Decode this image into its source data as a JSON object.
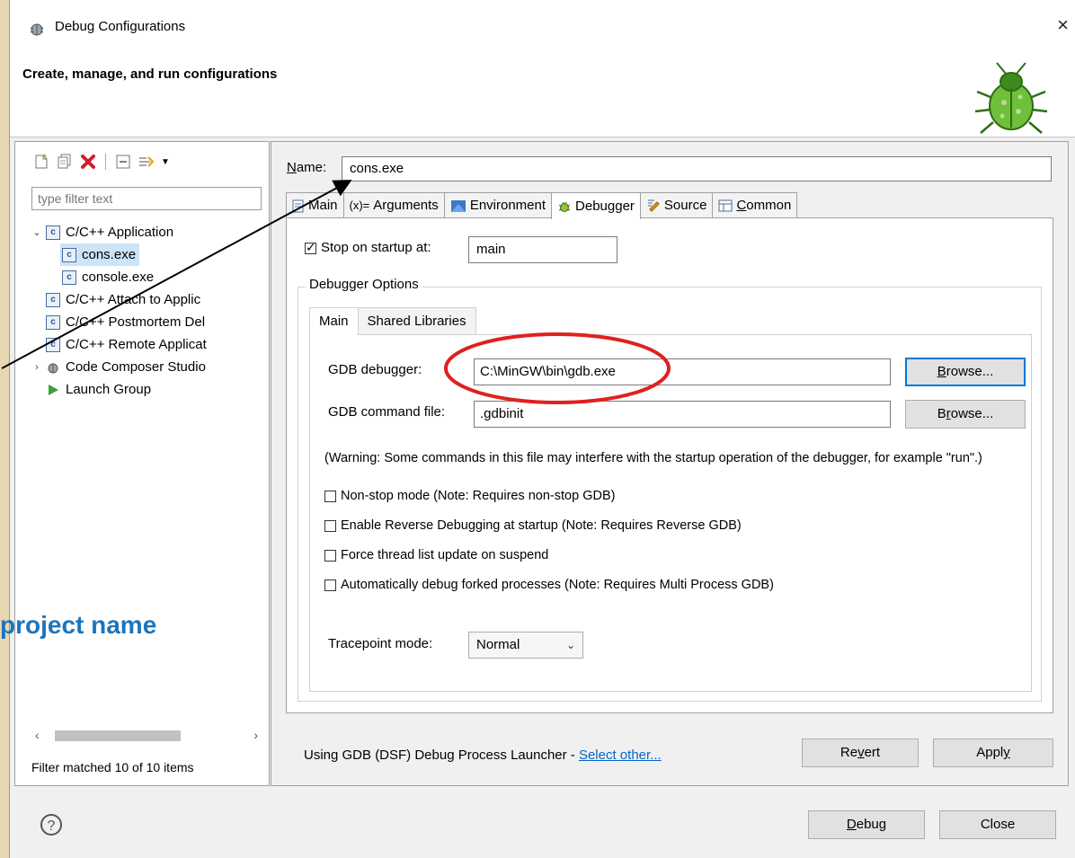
{
  "window": {
    "title": "Debug Configurations",
    "close": "×",
    "header_title": "Create, manage, and run configurations"
  },
  "left": {
    "filter_placeholder": "type filter text",
    "tree": [
      {
        "label": "C/C++ Application",
        "expanded": true
      },
      {
        "label": "cons.exe",
        "selected": true
      },
      {
        "label": "console.exe"
      },
      {
        "label": "C/C++ Attach to Applic"
      },
      {
        "label": "C/C++ Postmortem Del"
      },
      {
        "label": "C/C++ Remote Applicat"
      },
      {
        "label": "Code Composer Studio"
      },
      {
        "label": "Launch Group"
      }
    ],
    "status": "Filter matched 10 of 10 items"
  },
  "main": {
    "name_label": "Name:",
    "name_value": "cons.exe",
    "tabs": [
      "Main",
      "Arguments",
      "Environment",
      "Debugger",
      "Source",
      "Common"
    ],
    "active_tab": "Debugger",
    "stop_on_startup": {
      "label": "Stop on startup at:",
      "checked": true,
      "value": "main"
    },
    "debugger_options": {
      "title": "Debugger Options",
      "tabs": [
        "Main",
        "Shared Libraries"
      ],
      "gdb_label": "GDB debugger:",
      "gdb_value": "C:\\MinGW\\bin\\gdb.exe",
      "browse1": "Browse...",
      "cmd_label": "GDB command file:",
      "cmd_value": ".gdbinit",
      "browse2": "Browse...",
      "warning": "(Warning: Some commands in this file may interfere with the startup operation of the debugger, for example \"run\".)",
      "options": [
        {
          "label": "Non-stop mode (Note: Requires non-stop GDB)",
          "checked": false
        },
        {
          "label": "Enable Reverse Debugging at startup (Note: Requires Reverse GDB)",
          "checked": false
        },
        {
          "label": "Force thread list update on suspend",
          "checked": false
        },
        {
          "label": "Automatically debug forked processes (Note: Requires Multi Process GDB)",
          "checked": false
        }
      ],
      "tracepoint_label": "Tracepoint mode:",
      "tracepoint_value": "Normal"
    },
    "launcher_text": "Using GDB (DSF) Debug Process Launcher - ",
    "launcher_link": "Select other...",
    "revert": "Revert",
    "apply": "Apply"
  },
  "footer": {
    "help": "?",
    "debug": "Debug",
    "close": "Close"
  },
  "annotation": {
    "text": "project name",
    "text_color": "#1c75bc",
    "circle_color": "#e02020"
  }
}
